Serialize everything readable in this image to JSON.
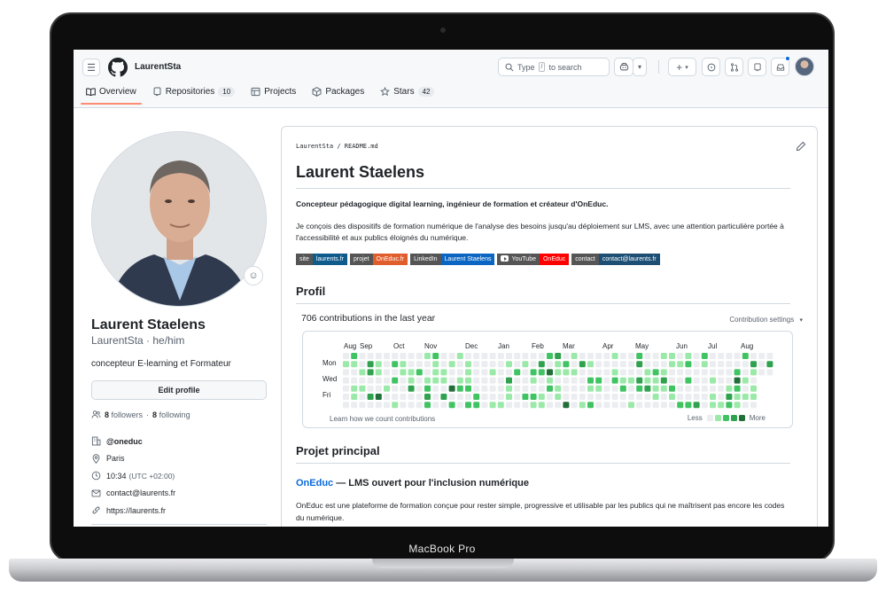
{
  "frame": {
    "label": "MacBook Pro"
  },
  "header": {
    "owner": "LaurentSta",
    "search_prefix": "Type",
    "search_key": "/",
    "search_suffix": "to search",
    "plus_label": "+"
  },
  "tabs": [
    {
      "label": "Overview",
      "count": ""
    },
    {
      "label": "Repositories",
      "count": "10"
    },
    {
      "label": "Projects",
      "count": ""
    },
    {
      "label": "Packages",
      "count": ""
    },
    {
      "label": "Stars",
      "count": "42"
    }
  ],
  "profile": {
    "name": "Laurent Staelens",
    "login_line": "LaurentSta · he/him",
    "bio": "concepteur E-learning et Formateur",
    "edit_label": "Edit profile",
    "followers_count": "8",
    "followers_label": "followers",
    "following_count": "8",
    "following_label": "following",
    "organization": "@oneduc",
    "location": "Paris",
    "local_time": "10:34",
    "timezone": "(UTC +02:00)",
    "email": "contact@laurents.fr",
    "website": "https://laurents.fr"
  },
  "readme": {
    "path": "LaurentSta / README.md",
    "title": "Laurent Staelens",
    "lead": "Concepteur pédagogique digital learning, ingénieur de formation et créateur d'OnEduc.",
    "paragraph": "Je conçois des dispositifs de formation numérique de l'analyse des besoins jusqu'au déploiement sur LMS, avec une attention particulière portée à l'accessibilité et aux publics éloignés du numérique.",
    "badges": [
      {
        "label": "site",
        "value": "laurents.fr",
        "color": "#0e5b8c"
      },
      {
        "label": "projet",
        "value": "OnEduc.fr",
        "color": "#e05d2c"
      },
      {
        "label": "LinkedIn",
        "value": "Laurent Staelens",
        "color": "#0a66c2"
      },
      {
        "label": "YouTube",
        "value": "OnEduc",
        "color": "#ff0000"
      },
      {
        "label": "contact",
        "value": "contact@laurents.fr",
        "color": "#1d4f74"
      }
    ],
    "profil_heading": "Profil",
    "contributions_title": "706 contributions in the last year",
    "contribution_settings": "Contribution settings",
    "months": [
      "Aug",
      "Sep",
      "Oct",
      "Nov",
      "Dec",
      "Jan",
      "Feb",
      "Mar",
      "Apr",
      "May",
      "Jun",
      "Jul",
      "Aug"
    ],
    "weekdays": [
      "Mon",
      "Wed",
      "Fri"
    ],
    "learn_link": "Learn how we count contributions",
    "legend_less": "Less",
    "legend_more": "More",
    "legend_colors": [
      "#ebedf0",
      "#9be9a8",
      "#40c463",
      "#30a14e",
      "#216e39"
    ],
    "project_heading": "Projet principal",
    "project_link": "OnEduc",
    "project_title_rest": " — LMS ouvert pour l'inclusion numérique",
    "project_paragraph": "OnEduc est une plateforme de formation conçue pour rester simple, progressive et utilisable par les publics qui ne maîtrisent pas encore les codes du numérique."
  }
}
